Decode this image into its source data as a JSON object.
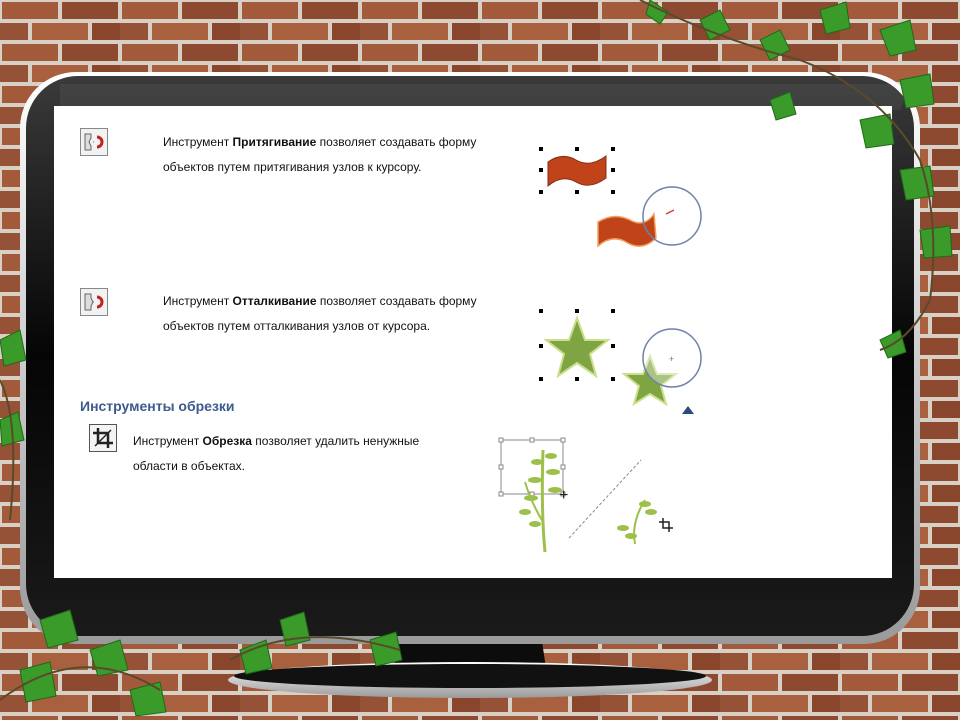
{
  "slide": {
    "attract": {
      "pre": "Инструмент ",
      "name": "Притягивание",
      "post": " позволяет создавать форму",
      "line2": "объектов путем притягивания узлов к курсору."
    },
    "repel": {
      "pre": "Инструмент ",
      "name": "Отталкивание",
      "post": " позволяет создавать форму",
      "line2": "объектов путем отталкивания узлов от курсора."
    },
    "section_title": "Инструменты обрезки",
    "crop": {
      "pre": "Инструмент ",
      "name": "Обрезка",
      "post": " позволяет удалить ненужные",
      "line2": "области в объектах."
    }
  },
  "colors": {
    "flag": "#c0431a",
    "star": "#7fa444",
    "section": "#3c5a8c",
    "leaf": "#9cc04a"
  },
  "icons": [
    "attract-tool-icon",
    "repel-tool-icon",
    "crop-tool-icon",
    "ivy-decoration",
    "brick-wall"
  ]
}
